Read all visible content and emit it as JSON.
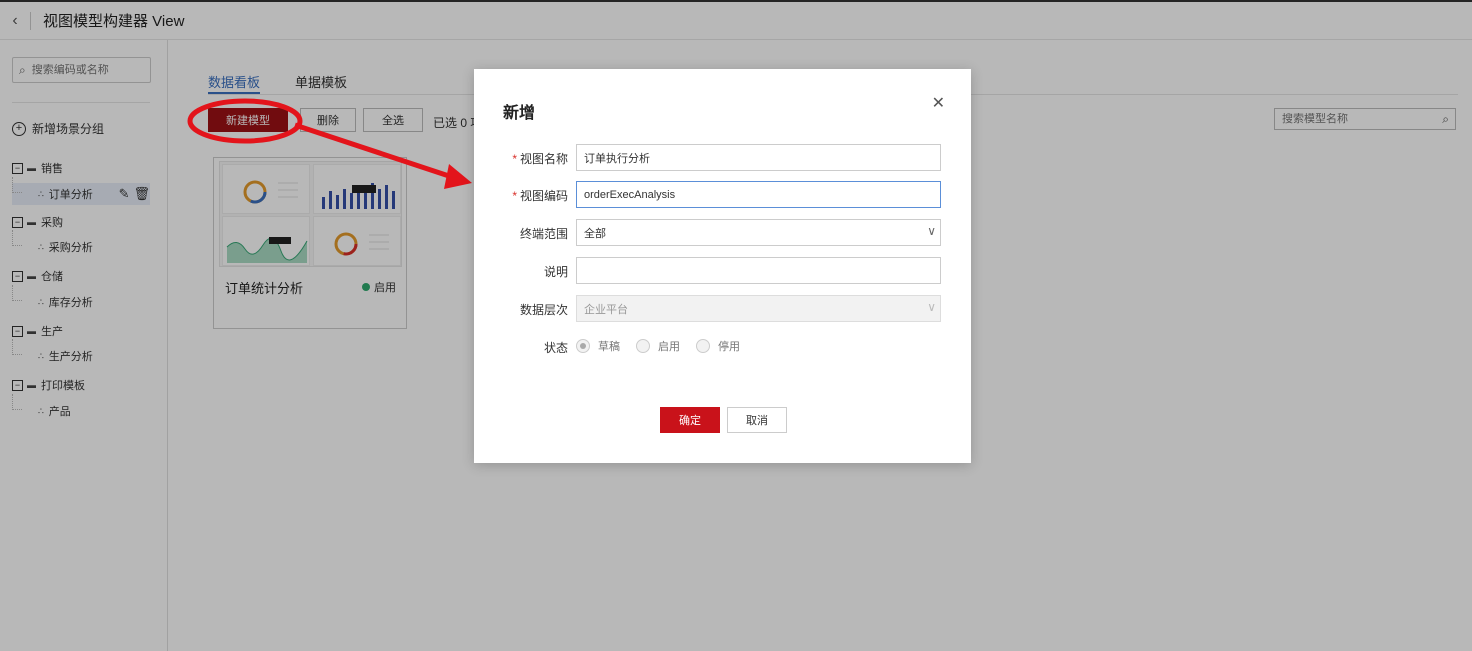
{
  "header": {
    "title": "视图模型构建器 View",
    "back_icon": "chevron-left-icon"
  },
  "sidebar": {
    "search_placeholder": "搜索编码或名称",
    "add_group_label": "新增场景分组",
    "groups": [
      {
        "label": "销售",
        "children": [
          {
            "label": "订单分析",
            "selected": true
          }
        ]
      },
      {
        "label": "采购",
        "children": [
          {
            "label": "采购分析"
          }
        ]
      },
      {
        "label": "仓储",
        "children": [
          {
            "label": "库存分析"
          }
        ]
      },
      {
        "label": "生产",
        "children": [
          {
            "label": "生产分析"
          }
        ]
      },
      {
        "label": "打印模板",
        "children": [
          {
            "label": "产品"
          }
        ]
      }
    ]
  },
  "main": {
    "tabs": [
      {
        "label": "数据看板",
        "active": true
      },
      {
        "label": "单据模板"
      }
    ],
    "toolbar": {
      "new_label": "新建模型",
      "delete_label": "删除",
      "select_all_label": "全选",
      "selected_count": "已选 0 项"
    },
    "search_placeholder": "搜索模型名称",
    "cards": [
      {
        "title": "订单统计分析",
        "status": "启用",
        "status_color": "#2eaa6e"
      }
    ]
  },
  "modal": {
    "title": "新增",
    "fields": {
      "view_name": {
        "label": "视图名称",
        "value": "订单执行分析",
        "required": true
      },
      "view_code": {
        "label": "视图编码",
        "value": "orderExecAnalysis",
        "required": true
      },
      "terminal": {
        "label": "终端范围",
        "value": "全部"
      },
      "description": {
        "label": "说明",
        "value": ""
      },
      "data_level": {
        "label": "数据层次",
        "value": "企业平台",
        "disabled": true
      },
      "status": {
        "label": "状态",
        "options": [
          "草稿",
          "启用",
          "停用"
        ],
        "selected": "草稿",
        "disabled": true
      }
    },
    "ok_label": "确定",
    "cancel_label": "取消"
  },
  "colors": {
    "brand_red": "#c9121a",
    "tab_blue": "#3a6fbf",
    "annotation_red": "#e3141b"
  }
}
